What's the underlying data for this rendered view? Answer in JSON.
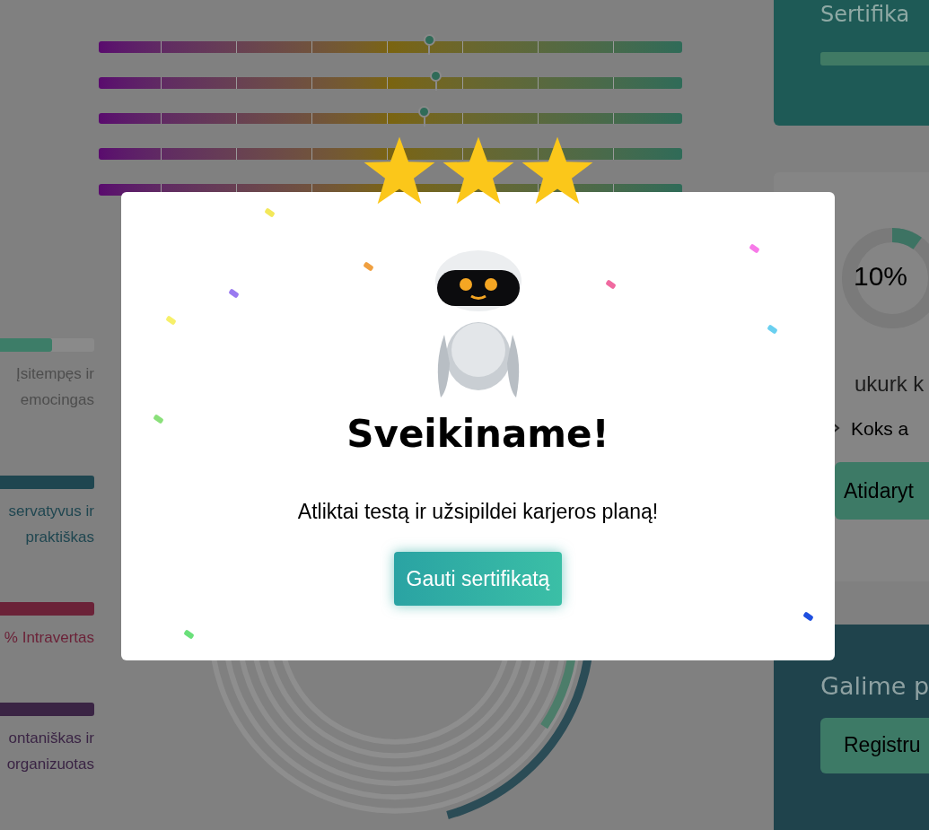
{
  "scale_bars": [
    {
      "kind": "marked",
      "level": 0.566
    },
    {
      "kind": "marked",
      "level": 0.577
    },
    {
      "kind": "marked",
      "level": 0.557
    },
    {
      "kind": "plain"
    },
    {
      "kind": "plain"
    }
  ],
  "traits": [
    {
      "kind": "meter",
      "level": 0.55,
      "color": "#3d7d68",
      "lines": [
        "Įsitempęs ir",
        "emocingas"
      ]
    },
    {
      "kind": "full",
      "color": "#1f4650",
      "lines": [
        "servatyvus ir",
        "praktiškas"
      ]
    },
    {
      "kind": "full",
      "color": "#6b2238",
      "lines": [
        "% Intravertas"
      ]
    },
    {
      "kind": "full",
      "color": "#3a2444",
      "lines": [
        "ontaniškas ir",
        "organizuotas"
      ]
    }
  ],
  "right_cards": [
    {
      "kind": "certificate",
      "title": "Sertifika",
      "level": 1.0
    },
    {
      "kind": "progress",
      "percent": "10%",
      "level": 0.1,
      "heading": "ukurk k",
      "item": "Koks a",
      "button": "Atidaryt"
    },
    {
      "kind": "register",
      "title": "Galime p",
      "button": "Registru"
    }
  ],
  "modal": {
    "stars": 3,
    "title": "Sveikiname!",
    "message": "Atliktai testą ir užsipildei karjeros planą!",
    "button": "Gauti sertifikatą"
  }
}
